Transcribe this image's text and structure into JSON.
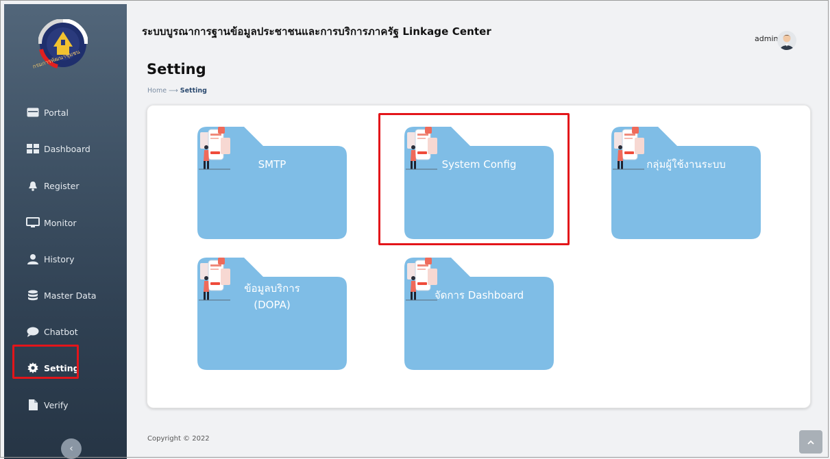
{
  "header": {
    "title": "ระบบบูรณาการฐานข้อมูลประชาชนและการบริการภาครัฐ Linkage Center",
    "user": "admin"
  },
  "sidebar": {
    "logo_text": "กรมการพัฒนาชุมชน",
    "items": [
      {
        "label": "Portal",
        "icon": "portal-icon"
      },
      {
        "label": "Dashboard",
        "icon": "dashboard-icon"
      },
      {
        "label": "Register",
        "icon": "bell-icon"
      },
      {
        "label": "Monitor",
        "icon": "monitor-icon"
      },
      {
        "label": "History",
        "icon": "user-icon"
      },
      {
        "label": "Master Data",
        "icon": "database-icon"
      },
      {
        "label": "Chatbot",
        "icon": "chat-icon"
      },
      {
        "label": "Setting",
        "icon": "gear-icon"
      },
      {
        "label": "Verify",
        "icon": "file-icon"
      }
    ],
    "active": "Setting"
  },
  "page": {
    "title": "Setting",
    "breadcrumb": {
      "home": "Home",
      "arrow": "⟶",
      "current": "Setting"
    }
  },
  "folders": [
    {
      "label": "SMTP",
      "label2": ""
    },
    {
      "label": "System Config",
      "label2": ""
    },
    {
      "label": "กลุ่มผู้ใช้งานระบบ",
      "label2": ""
    },
    {
      "label": "ข้อมูลบริการ",
      "label2": "(DOPA)"
    },
    {
      "label": "จัดการ Dashboard",
      "label2": ""
    }
  ],
  "footer": {
    "copyright": "Copyright © 2022"
  },
  "colors": {
    "folder": "#7fbde6",
    "highlight": "#e3151a",
    "sidebar_top": "#52667a",
    "sidebar_bottom": "#263545"
  }
}
